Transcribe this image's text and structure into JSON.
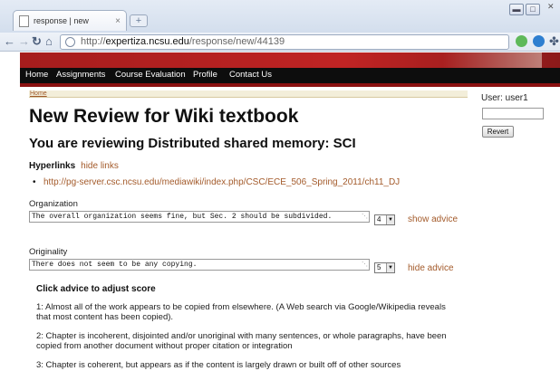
{
  "browser": {
    "tab_title": "response | new",
    "tab_close": "×",
    "new_tab": "+",
    "url_prefix": "http://",
    "url_host": "expertiza.ncsu.edu",
    "url_path": "/response/new/44139"
  },
  "site_nav": [
    "Home",
    "Assignments",
    "Course Evaluation",
    "Profile",
    "Contact Us"
  ],
  "breadcrumb": "Home",
  "page_title": "New Review for Wiki textbook",
  "subtitle": "You are reviewing Distributed shared memory: SCI",
  "hyperlinks": {
    "label": "Hyperlinks",
    "toggle": "hide links",
    "link": "http://pg-server.csc.ncsu.edu/mediawiki/index.php/CSC/ECE_506_Spring_2011/ch11_DJ"
  },
  "questions": [
    {
      "label": "Organization",
      "comment": "The overall organization seems fine, but Sec. 2 should be subdivided.",
      "score": "4",
      "advice_toggle": "show advice"
    },
    {
      "label": "Originality",
      "comment": "There does not seem to be any copying.",
      "score": "5",
      "advice_toggle": "hide advice"
    }
  ],
  "advice": {
    "title": "Click advice to adjust score",
    "items": [
      "1: Almost all of the work appears to be copied from elsewhere. (A Web search via Google/Wikipedia reveals that most content has been copied).",
      "2: Chapter is incoherent, disjointed and/or unoriginal with many sentences, or whole paragraphs, have been copied from another document without proper citation or integration",
      "3: Chapter is coherent, but appears as if the content is largely drawn or built off of other sources"
    ]
  },
  "sidebar": {
    "user_label": "User: user1",
    "revert_label": "Revert"
  }
}
